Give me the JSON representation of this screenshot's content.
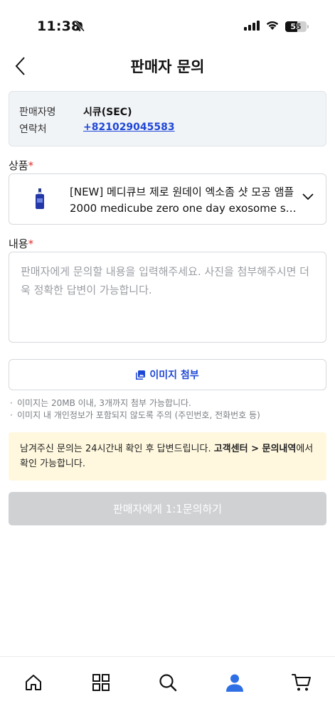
{
  "status_bar": {
    "time": "11:38",
    "battery": "55"
  },
  "header": {
    "title": "판매자 문의"
  },
  "seller": {
    "name_label": "판매자명",
    "name_value": "시큐(SEC)",
    "contact_label": "연락처",
    "contact_value": "+821029045583"
  },
  "product_section": {
    "label": "상품",
    "required_mark": "*",
    "name_line1": "[NEW] 메디큐브 제로 원데이 엑소좀 샷 모공 앰플",
    "name_line2": "2000 medicube zero one day exosome sho..."
  },
  "content_section": {
    "label": "내용",
    "required_mark": "*",
    "placeholder": "판매자에게 문의할 내용을 입력해주세요. 사진을 첨부해주시면 더욱 정확한 답변이 가능합니다."
  },
  "attach": {
    "label": "이미지 첨부"
  },
  "notes": [
    "이미지는 20MB 이내, 3개까지 첨부 가능합니다.",
    "이미지 내 개인정보가 포함되지 않도록 주의 (주민번호, 전화번호 등)"
  ],
  "notice": {
    "prefix": "남겨주신 문의는 24시간내 확인 후 답변드립니다. ",
    "link": "고객센터 > 문의내역",
    "suffix": "에서 확인 가능합니다."
  },
  "submit": {
    "label": "판매자에게 1:1문의하기"
  },
  "bottom_nav": {
    "items": [
      "home-icon",
      "grid-icon",
      "search-icon",
      "person-icon",
      "cart-icon"
    ],
    "active": "person-icon"
  },
  "colors": {
    "accent": "#1f47d6",
    "active_nav": "#2f6fe5",
    "notice_bg": "#fff8df",
    "disabled_button": "#cfd1d3"
  }
}
